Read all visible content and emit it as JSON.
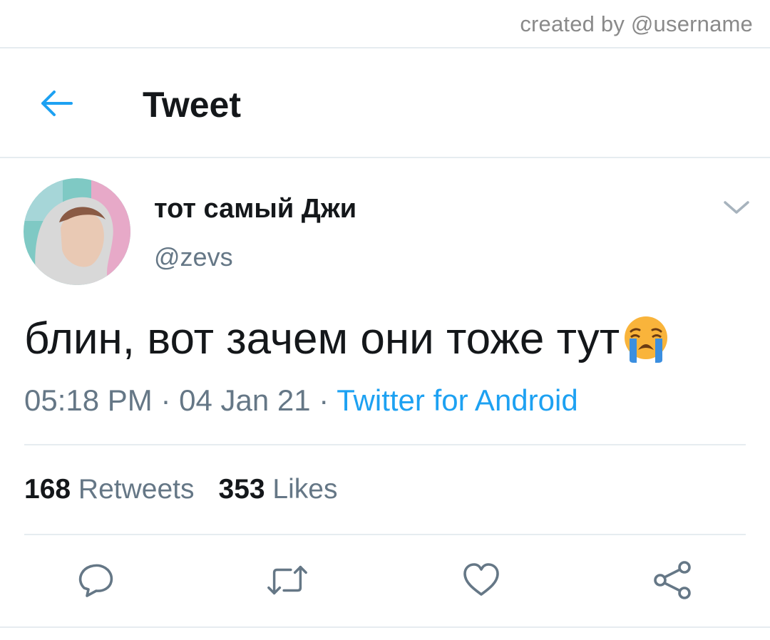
{
  "watermark": {
    "credit": "created by @username"
  },
  "header": {
    "title": "Tweet",
    "back_icon": "arrow-left-icon"
  },
  "author": {
    "display_name": "тот самый Джи",
    "handle": "@zevs",
    "menu_icon": "chevron-down-icon"
  },
  "tweet": {
    "text": "блин, вот зачем они тоже тут",
    "emoji": "loudly-crying-face",
    "time": "05:18 PM",
    "date": "04 Jan 21",
    "separator": "·",
    "source": "Twitter for Android"
  },
  "stats": {
    "retweets_count": "168",
    "retweets_label": "Retweets",
    "likes_count": "353",
    "likes_label": "Likes"
  },
  "actions": [
    "reply-icon",
    "retweet-icon",
    "like-icon",
    "share-icon"
  ],
  "colors": {
    "accent": "#1da1f2",
    "text_primary": "#14171a",
    "text_secondary": "#657786",
    "divider": "#e6ecf0"
  }
}
